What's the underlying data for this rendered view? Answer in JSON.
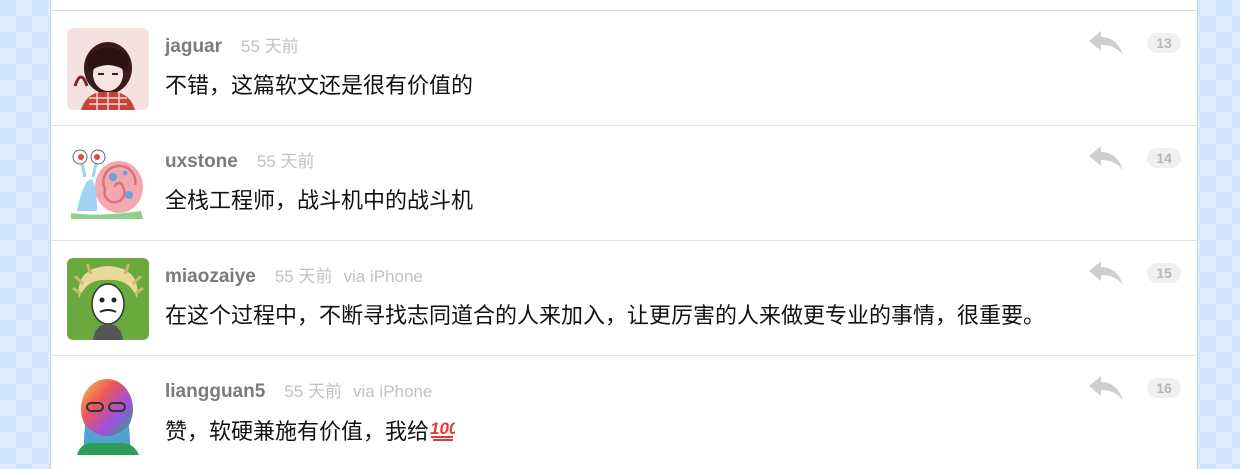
{
  "replies": [
    {
      "username": "jaguar",
      "time": "55 天前",
      "via": "",
      "content": "不错，这篇软文还是很有价值的",
      "floor": "13",
      "avatar_icon": "jaguar-avatar"
    },
    {
      "username": "uxstone",
      "time": "55 天前",
      "via": "",
      "content": "全栈工程师，战斗机中的战斗机",
      "floor": "14",
      "avatar_icon": "snail-avatar"
    },
    {
      "username": "miaozaiye",
      "time": "55 天前",
      "via": "via iPhone",
      "content": "在这个过程中，不断寻找志同道合的人来加入，让更厉害的人来做更专业的事情，很重要。",
      "floor": "15",
      "avatar_icon": "einstein-avatar"
    },
    {
      "username": "liangguan5",
      "time": "55 天前",
      "via": "via iPhone",
      "content": "赞，软硬兼施有价值，我给",
      "content_emoji": "hundred-points-emoji",
      "floor": "16",
      "avatar_icon": "jobs-avatar"
    }
  ],
  "colors": {
    "username": "#7b7b7b",
    "meta": "#c2c2c2",
    "floor_bg": "#f0f0f0",
    "floor_text": "#b6b6b6"
  }
}
